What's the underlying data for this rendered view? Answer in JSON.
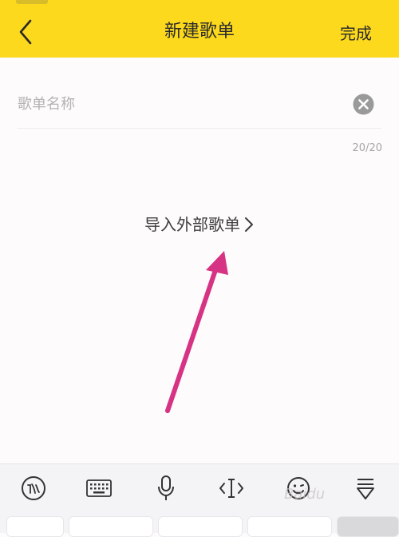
{
  "header": {
    "title": "新建歌单",
    "done_label": "完成",
    "background": "#fcd91d"
  },
  "form": {
    "name_placeholder": "歌单名称",
    "name_value": "",
    "counter": "20/20"
  },
  "import_link": {
    "label": "导入外部歌单",
    "chevron": ">"
  },
  "annotation": {
    "arrow_color": "#d63384"
  },
  "keyboard_toolbar": {
    "tools": [
      {
        "icon": "ifly-logo-icon"
      },
      {
        "icon": "keyboard-icon"
      },
      {
        "icon": "microphone-icon"
      },
      {
        "icon": "cursor-move-icon"
      },
      {
        "icon": "emoji-icon"
      },
      {
        "icon": "collapse-keyboard-icon"
      }
    ]
  },
  "watermark": {
    "text": "Baidu"
  }
}
